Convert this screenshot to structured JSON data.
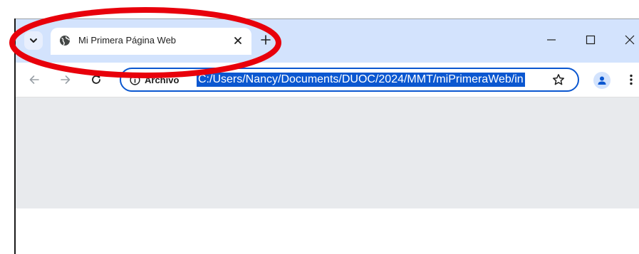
{
  "tab": {
    "title": "Mi Primera Página Web",
    "favicon": "globe-icon",
    "close_icon": "close-icon"
  },
  "tabstrip": {
    "search_icon": "chevron-down-icon",
    "new_tab_icon": "plus-icon",
    "background_color": "#d3e3fd"
  },
  "window_controls": {
    "minimize": "minimize-icon",
    "maximize": "maximize-icon",
    "close": "window-close-icon"
  },
  "toolbar": {
    "back": "back-arrow-icon",
    "forward": "forward-arrow-icon",
    "reload": "reload-icon",
    "bookmark": "star-icon",
    "profile": "person-icon",
    "menu": "kebab-menu-icon"
  },
  "omnibox": {
    "site_label": "Archivo",
    "url": "C:/Users/Nancy/Documents/DUOC/2024/MMT/miPrimeraWeb/in",
    "selection_color": "#0b57d0"
  },
  "annotation": {
    "type": "red-ellipse",
    "color": "#e8000b"
  }
}
